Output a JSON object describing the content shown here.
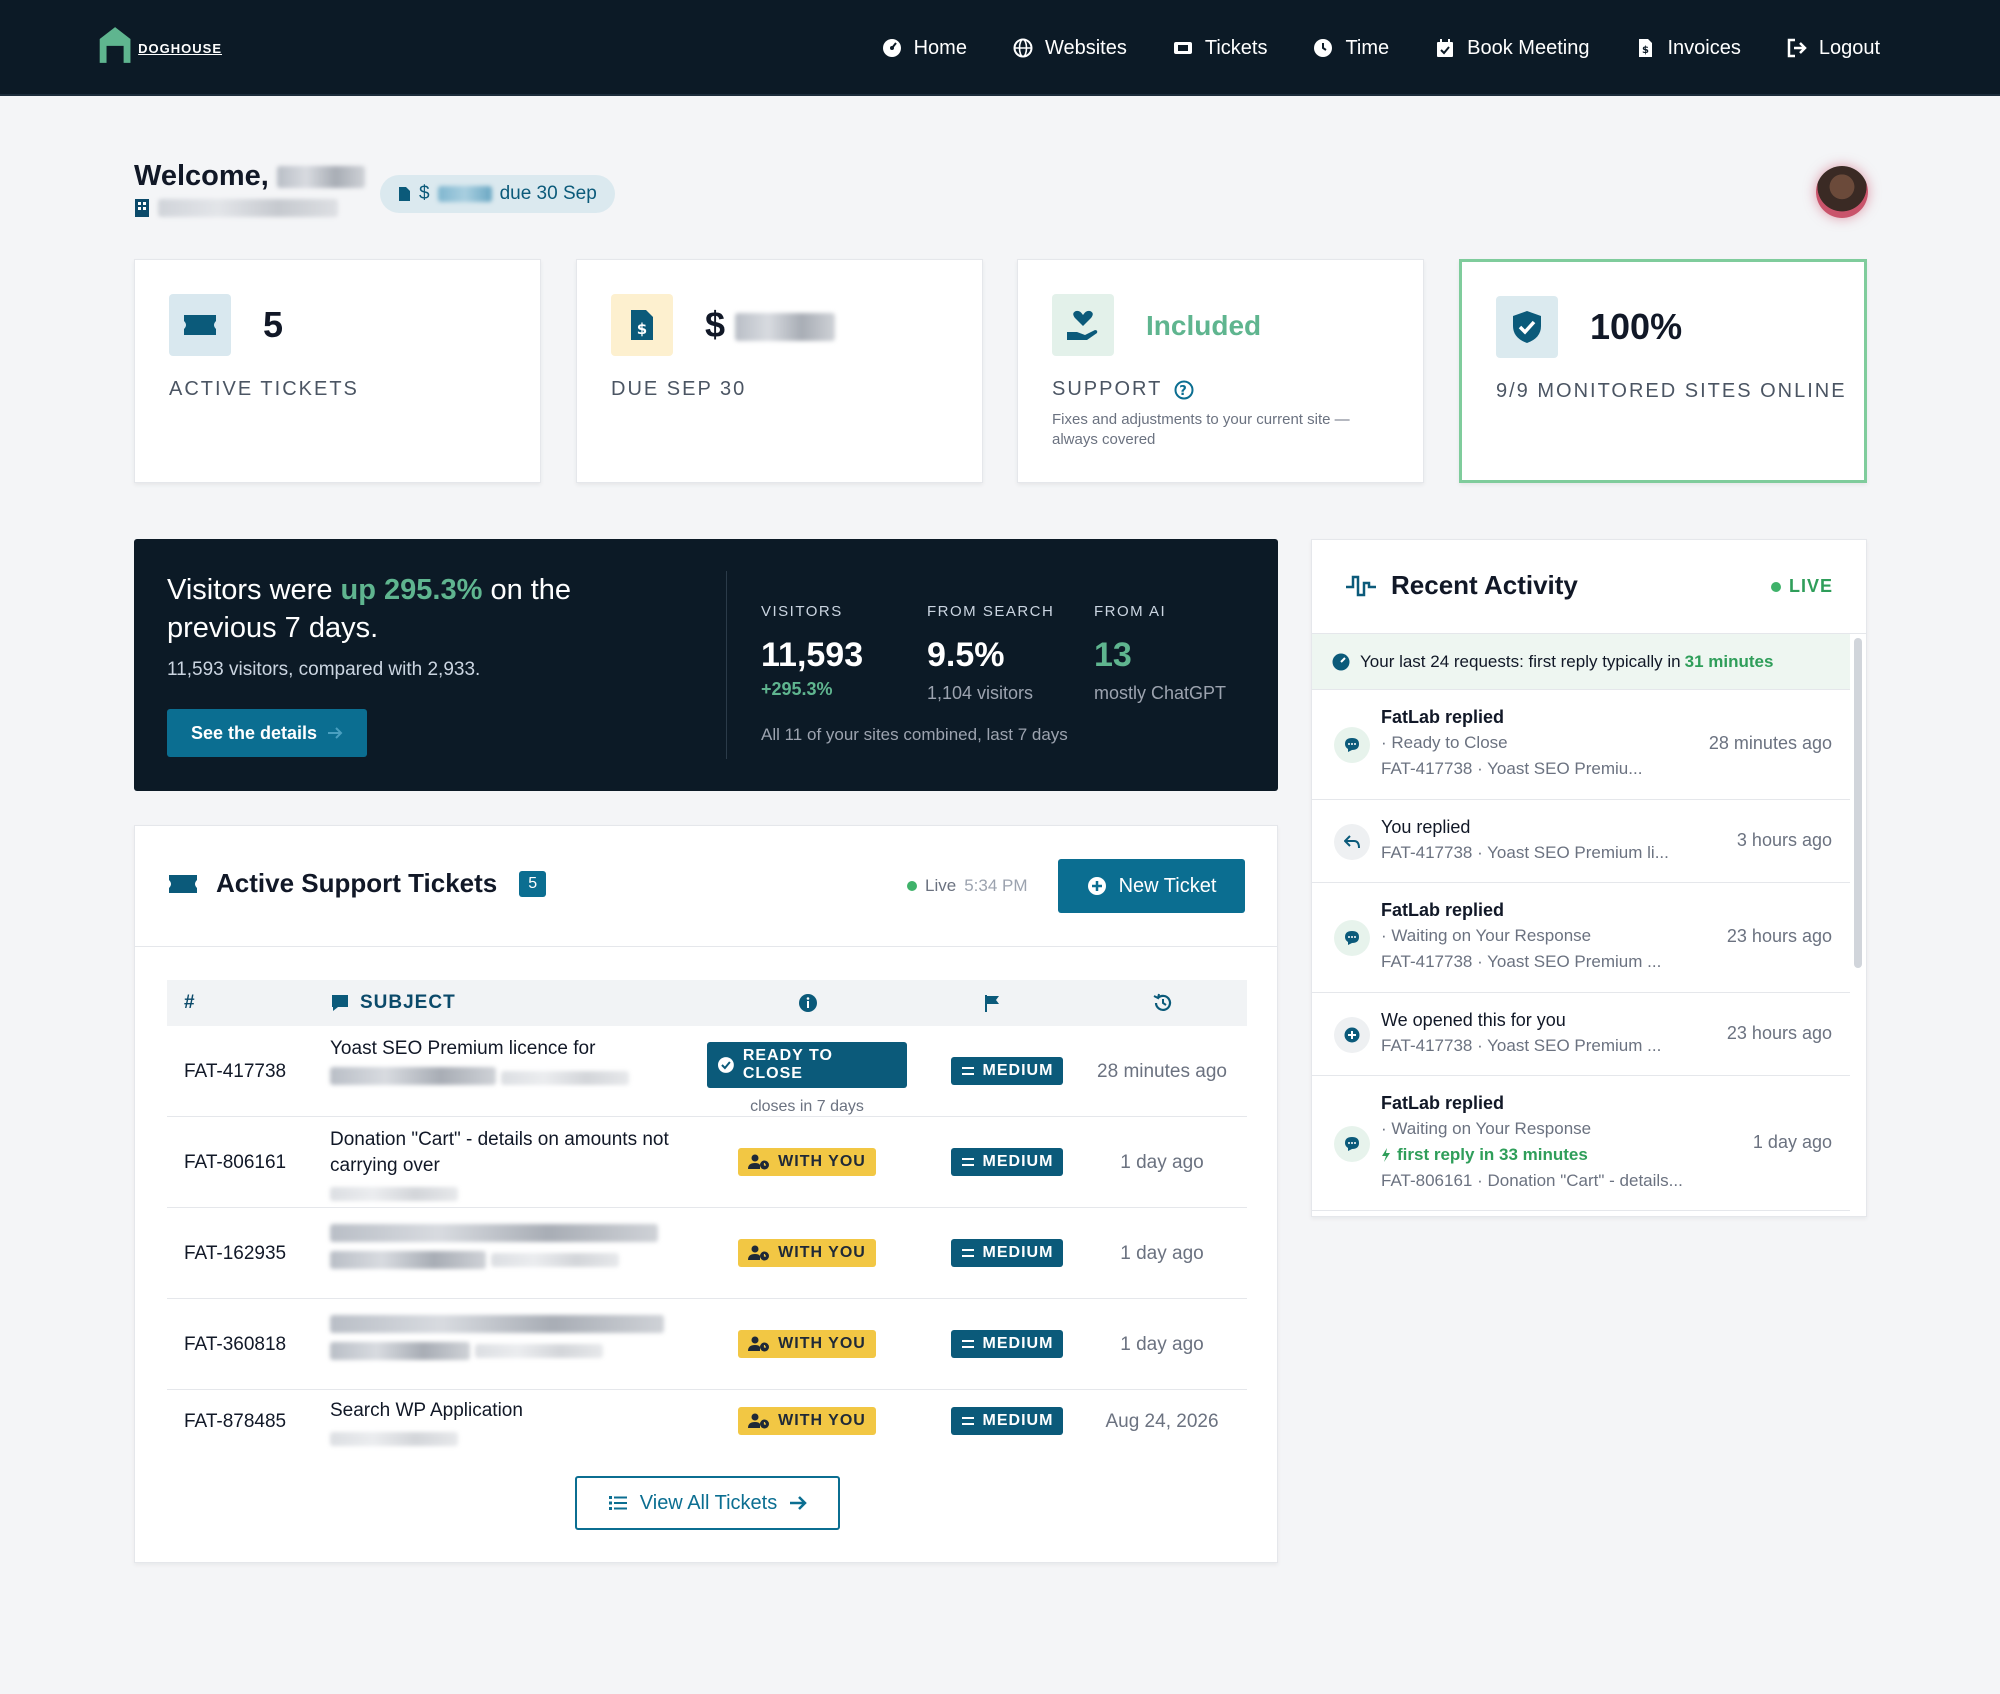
{
  "nav": {
    "brand": "DOGHOUSE",
    "items": [
      {
        "label": "Home",
        "icon": "dashboard-icon"
      },
      {
        "label": "Websites",
        "icon": "globe-icon"
      },
      {
        "label": "Tickets",
        "icon": "ticket-icon"
      },
      {
        "label": "Time",
        "icon": "clock-icon"
      },
      {
        "label": "Book Meeting",
        "icon": "calendar-icon"
      },
      {
        "label": "Invoices",
        "icon": "invoice-icon"
      },
      {
        "label": "Logout",
        "icon": "logout-icon"
      }
    ]
  },
  "welcome": {
    "greeting": "Welcome,",
    "due_prefix": "$",
    "due_suffix": "due 30 Sep"
  },
  "cards": [
    {
      "value": "5",
      "label": "ACTIVE TICKETS"
    },
    {
      "value": "$",
      "label": "DUE SEP 30"
    },
    {
      "value": "Included",
      "label": "SUPPORT",
      "sub": "Fixes and adjustments to your current site — always covered"
    },
    {
      "value": "100%",
      "label": "9/9 MONITORED SITES ONLINE"
    }
  ],
  "visitors": {
    "headline_pre": "Visitors were",
    "headline_hl": "up 295.3%",
    "headline_post": "on the previous 7 days.",
    "compare": "11,593 visitors, compared with 2,933.",
    "button": "See the details",
    "metrics": [
      {
        "head": "VISITORS",
        "value": "11,593",
        "sub": "+295.3%"
      },
      {
        "head": "FROM SEARCH",
        "value": "9.5%",
        "sub": "1,104 visitors"
      },
      {
        "head": "FROM AI",
        "value": "13",
        "sub": "mostly ChatGPT"
      }
    ],
    "footnote": "All 11 of your sites combined, last 7 days"
  },
  "tickets": {
    "title": "Active Support Tickets",
    "count": "5",
    "live_label": "Live",
    "live_time": "5:34 PM",
    "new_button": "New Ticket",
    "col_id": "#",
    "col_subject": "SUBJECT",
    "rows": [
      {
        "id": "FAT-417738",
        "subject": "Yoast SEO Premium licence for",
        "status": "READY TO CLOSE",
        "status_note": "closes in 7 days",
        "priority": "MEDIUM",
        "ago": "28 minutes ago"
      },
      {
        "id": "FAT-806161",
        "subject": "Donation \"Cart\" - details on amounts not carrying over",
        "status": "WITH YOU",
        "status_note": "",
        "priority": "MEDIUM",
        "ago": "1 day ago"
      },
      {
        "id": "FAT-162935",
        "subject": "",
        "status": "WITH YOU",
        "status_note": "",
        "priority": "MEDIUM",
        "ago": "1 day ago"
      },
      {
        "id": "FAT-360818",
        "subject": "",
        "status": "WITH YOU",
        "status_note": "",
        "priority": "MEDIUM",
        "ago": "1 day ago"
      },
      {
        "id": "FAT-878485",
        "subject": "Search WP Application",
        "status": "WITH YOU",
        "status_note": "",
        "priority": "MEDIUM",
        "ago": "Aug 24, 2026"
      }
    ],
    "view_all": "View All Tickets"
  },
  "activity": {
    "title": "Recent Activity",
    "live": "LIVE",
    "note_pre": "Your last 24 requests: first reply typically in",
    "note_hl": "31 minutes",
    "items": [
      {
        "line1": "FatLab replied",
        "line2": "· Ready to Close",
        "line3": "FAT-417738 · Yoast SEO Premiu...",
        "extra": "",
        "when": "28 minutes ago"
      },
      {
        "line1": "You replied",
        "line2": "",
        "line3": "FAT-417738 · Yoast SEO Premium li...",
        "extra": "",
        "when": "3 hours ago"
      },
      {
        "line1": "FatLab replied",
        "line2": "· Waiting on Your Response",
        "line3": "FAT-417738 · Yoast SEO Premium ...",
        "extra": "",
        "when": "23 hours ago"
      },
      {
        "line1": "We opened this for you",
        "line2": "",
        "line3": "FAT-417738 · Yoast SEO Premium ...",
        "extra": "",
        "when": "23 hours ago"
      },
      {
        "line1": "FatLab replied",
        "line2": "· Waiting on Your Response",
        "line3": "FAT-806161 · Donation \"Cart\" - details...",
        "extra": "first reply in 33 minutes",
        "when": "1 day ago"
      }
    ]
  },
  "colors": {
    "navy": "#0c1a26",
    "teal": "#0b6e91",
    "green": "#2f9e5a",
    "yellow": "#f2c744"
  }
}
